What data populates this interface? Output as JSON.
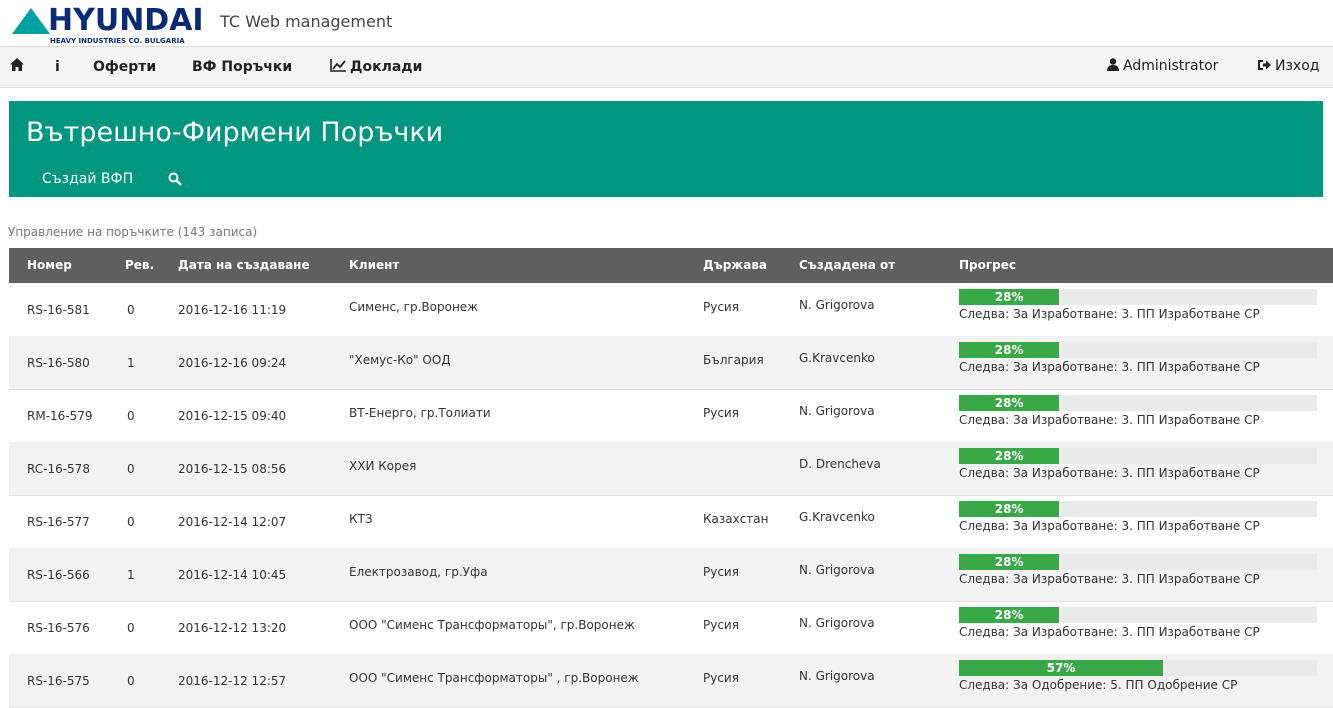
{
  "header": {
    "logo_text": "HYUNDAI",
    "logo_subtext": "HEAVY INDUSTRIES CO. BULGARIA",
    "app_title": "TC Web management"
  },
  "nav": {
    "home_icon": "home-icon",
    "info_label": "i",
    "offers": "Оферти",
    "orders": "ВФ Поръчки",
    "reports": "Доклади",
    "user": "Administrator",
    "logout": "Изход"
  },
  "banner": {
    "title": "Вътрешно-Фирмени Поръчки",
    "create": "Създай ВФП"
  },
  "caption": "Управление на поръчките (143 записа)",
  "table": {
    "headers": [
      "Номер",
      "Рев.",
      "Дата на създаване",
      "Клиент",
      "Държава",
      "Създадена от",
      "Прогрес"
    ],
    "rows": [
      {
        "id": "RS-16-581",
        "rev": "0",
        "date": "2016-12-16 11:19",
        "client": "Сименс, гр.Воронеж",
        "country": "Русия",
        "by": "N. Grigorova",
        "progress": 28,
        "progress_label": "28%",
        "next": "Следва: За Изработване: 3. ПП Изработване СР"
      },
      {
        "id": "RS-16-580",
        "rev": "1",
        "date": "2016-12-16 09:24",
        "client": "\"Хемус-Ко\" ООД",
        "country": "България",
        "by": "G.Kravcenko",
        "progress": 28,
        "progress_label": "28%",
        "next": "Следва: За Изработване: 3. ПП Изработване СР"
      },
      {
        "id": "RM-16-579",
        "rev": "0",
        "date": "2016-12-15 09:40",
        "client": "ВТ-Енерго, гр.Толиати",
        "country": "Русия",
        "by": "N. Grigorova",
        "progress": 28,
        "progress_label": "28%",
        "next": "Следва: За Изработване: 3. ПП Изработване СР"
      },
      {
        "id": "RC-16-578",
        "rev": "0",
        "date": "2016-12-15 08:56",
        "client": "ХХИ Корея",
        "country": "",
        "by": "D. Drencheva",
        "progress": 28,
        "progress_label": "28%",
        "next": "Следва: За Изработване: 3. ПП Изработване СР"
      },
      {
        "id": "RS-16-577",
        "rev": "0",
        "date": "2016-12-14 12:07",
        "client": "КТЗ",
        "country": "Казахстан",
        "by": "G.Kravcenko",
        "progress": 28,
        "progress_label": "28%",
        "next": "Следва: За Изработване: 3. ПП Изработване СР"
      },
      {
        "id": "RS-16-566",
        "rev": "1",
        "date": "2016-12-14 10:45",
        "client": "Електрозавод, гр.Уфа",
        "country": "Русия",
        "by": "N. Grigorova",
        "progress": 28,
        "progress_label": "28%",
        "next": "Следва: За Изработване: 3. ПП Изработване СР"
      },
      {
        "id": "RS-16-576",
        "rev": "0",
        "date": "2016-12-12 13:20",
        "client": "ООО \"Сименс Трансформаторы\", гр.Воронеж",
        "country": "Русия",
        "by": "N. Grigorova",
        "progress": 28,
        "progress_label": "28%",
        "next": "Следва: За Изработване: 3. ПП Изработване СР"
      },
      {
        "id": "RS-16-575",
        "rev": "0",
        "date": "2016-12-12 12:57",
        "client": "ООО \"Сименс Трансформаторы\" , гр.Воронеж",
        "country": "Русия",
        "by": "N. Grigorova",
        "progress": 57,
        "progress_label": "57%",
        "next": "Следва: За Одобрение: 5. ПП Одобрение СР"
      }
    ]
  },
  "colors": {
    "banner": "#009680",
    "progress": "#3aa849",
    "header_row": "#5f5f5f",
    "logo_blue": "#0b2a75",
    "logo_teal": "#00a3a0"
  }
}
